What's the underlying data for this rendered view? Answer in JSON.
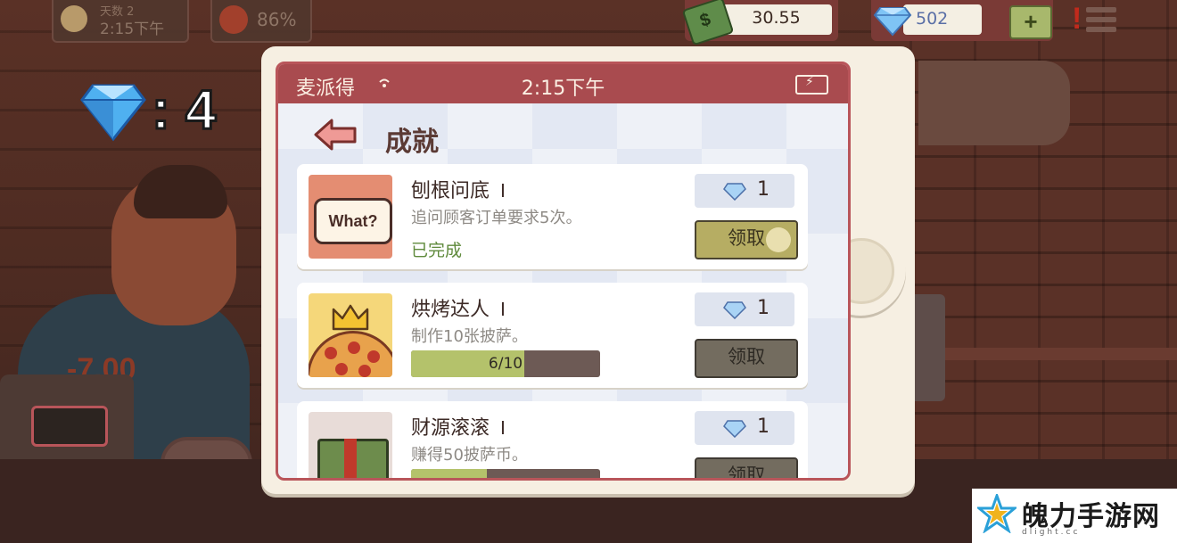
{
  "hud": {
    "day_label": "天数 2",
    "time": "2:15下午",
    "mood": "86%",
    "cash": "30.55",
    "gems": "502",
    "plus": "+",
    "alert": "!"
  },
  "customer": {
    "price_change": "-7.00"
  },
  "gem_counter": {
    "text": ": 4"
  },
  "phone": {
    "app_name": "麦派得",
    "time": "2:15下午",
    "title": "成就",
    "achievements": [
      {
        "name": "刨根问底",
        "level": "I",
        "desc": "追问顾客订单要求5次。",
        "status": "已完成",
        "reward": "1",
        "claim": "领取",
        "thumb_text": "What?"
      },
      {
        "name": "烘烤达人",
        "level": "I",
        "desc": "制作10张披萨。",
        "progress_text": "6/10",
        "progress": 0.6,
        "reward": "1",
        "claim": "领取"
      },
      {
        "name": "财源滚滚",
        "level": "I",
        "desc": "赚得50披萨币。",
        "progress": 0.4,
        "reward": "1",
        "claim": "领取"
      }
    ]
  },
  "watermark": {
    "name": "魄力手游网",
    "sub": "dlight.cc"
  },
  "colors": {
    "header": "#a94b4f",
    "claim_active": "#b6ad63",
    "claim_disabled": "#736c5f",
    "progress_fill": "#b4c26b"
  }
}
